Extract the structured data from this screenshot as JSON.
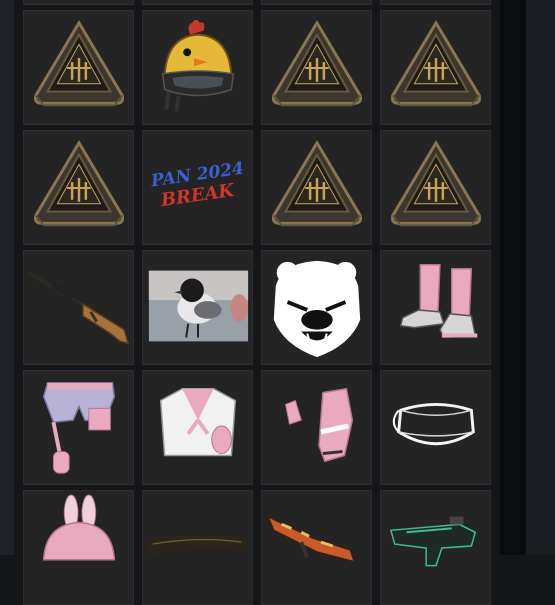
{
  "inventory": {
    "items": [
      {
        "icon": "crate-icon"
      },
      {
        "icon": "crate-icon"
      },
      {
        "icon": "crate-icon"
      },
      {
        "icon": "crate-icon"
      },
      {
        "icon": "crate-icon"
      },
      {
        "icon": "chicken-helmet-icon"
      },
      {
        "icon": "crate-icon"
      },
      {
        "icon": "crate-icon"
      },
      {
        "icon": "crate-icon"
      },
      {
        "icon": "spray-graffiti-icon",
        "line1": "PAN 2024",
        "line2": "BREAK"
      },
      {
        "icon": "crate-icon"
      },
      {
        "icon": "crate-icon"
      },
      {
        "icon": "sniper-rifle-icon"
      },
      {
        "icon": "bird-photo-icon"
      },
      {
        "icon": "bear-emblem-icon"
      },
      {
        "icon": "pink-boots-icon"
      },
      {
        "icon": "pink-shorts-icon"
      },
      {
        "icon": "sailor-top-icon"
      },
      {
        "icon": "pink-gloves-icon"
      },
      {
        "icon": "face-mask-icon"
      },
      {
        "icon": "bunny-helmet-icon"
      },
      {
        "icon": "dark-item-icon"
      },
      {
        "icon": "camo-rifle-icon"
      },
      {
        "icon": "smg-icon"
      }
    ]
  },
  "colors": {
    "tile_bg": "#242424",
    "crate_gold": "#c9a35a",
    "pink": "#e9a9bf",
    "graffiti_blue": "#3a5fd0",
    "graffiti_red": "#d0342c"
  }
}
